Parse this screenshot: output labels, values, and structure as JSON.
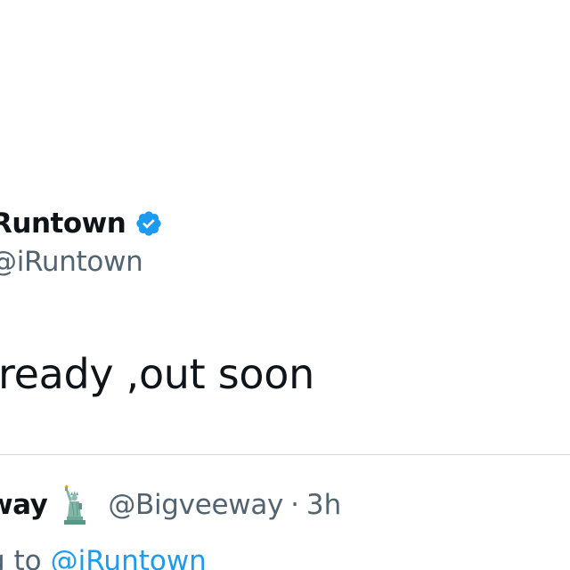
{
  "tweet": {
    "author": {
      "display_name": "Runtown",
      "handle": "@iRuntown",
      "verified": true,
      "verified_icon": "verified-badge-icon"
    },
    "text": "ready ,out soon"
  },
  "reply": {
    "author": {
      "display_name": "way",
      "emoji_icon": "statue-of-liberty-icon",
      "handle": "@Bigveeway",
      "separator": "·",
      "time": "3h"
    },
    "replying_to_prefix": "g to",
    "replying_to_handle": "@iRuntown"
  },
  "colors": {
    "primary_text": "#0f1419",
    "secondary_text": "#536471",
    "link_blue": "#1d9bf0",
    "divider": "#cfd9de"
  }
}
